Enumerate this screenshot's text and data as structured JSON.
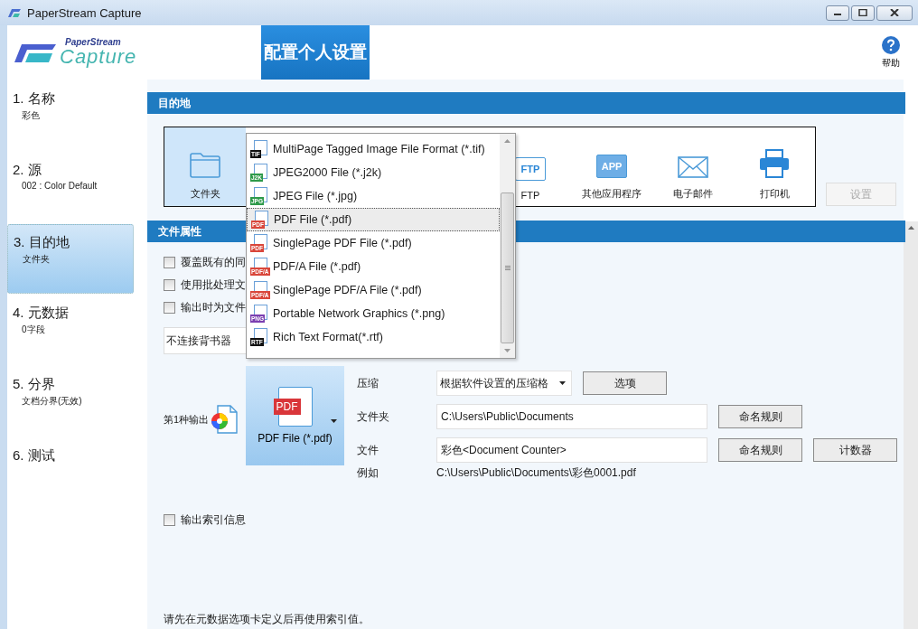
{
  "window": {
    "title": "PaperStream Capture"
  },
  "header": {
    "logo_top": "PaperStream",
    "logo_bottom": "Capture",
    "page_title": "配置个人设置",
    "help": "帮助"
  },
  "steps": [
    {
      "title": "1. 名称",
      "subtitle": "彩色",
      "selected": false
    },
    {
      "title": "2. 源",
      "subtitle": "002 : Color Default",
      "selected": false
    },
    {
      "title": "3. 目的地",
      "subtitle": "文件夹",
      "selected": true
    },
    {
      "title": "4. 元数据",
      "subtitle": "0字段",
      "selected": false
    },
    {
      "title": "5. 分界",
      "subtitle": "文档分界(无效)",
      "selected": false
    },
    {
      "title": "6. 测试",
      "selected": false
    }
  ],
  "destination": {
    "heading": "目的地",
    "items": [
      {
        "kind": "folder",
        "label": "文件夹",
        "selected": true
      },
      {
        "kind": "ftp",
        "label": "FTP",
        "icon_text": "FTP",
        "selected": false
      },
      {
        "kind": "app",
        "label": "其他应用程序",
        "icon_text": "APP",
        "selected": false
      },
      {
        "kind": "email",
        "label": "电子邮件",
        "selected": false
      },
      {
        "kind": "printer",
        "label": "打印机",
        "selected": false
      }
    ],
    "settings_button": {
      "label": "设置",
      "disabled": true
    }
  },
  "file_properties": {
    "heading": "文件属性",
    "options": [
      {
        "label": "覆盖既有的同",
        "checked": false
      },
      {
        "label": "使用批处理文",
        "checked": false
      },
      {
        "label": "输出时为文件",
        "checked": false
      }
    ],
    "endorser": "不连接背书器",
    "output_label": "第1种输出",
    "format": {
      "icon_text": "PDF",
      "label": "PDF File (*.pdf)"
    },
    "compression": {
      "label": "压缩",
      "value": "根据软件设置的压缩格",
      "button": "选项"
    },
    "folder": {
      "label": "文件夹",
      "value": "C:\\Users\\Public\\Documents",
      "button": "命名规则"
    },
    "file": {
      "label": "文件",
      "value": "彩色<Document Counter>",
      "button": "命名规则",
      "button_2": "计数器"
    },
    "example": {
      "label": "例如",
      "value": "C:\\Users\\Public\\Documents\\彩色0001.pdf"
    },
    "index_option": {
      "label": "输出索引信息",
      "checked": false
    },
    "note": "请先在元数据选项卡定义后再使用索引值。"
  },
  "format_menu": {
    "items": [
      {
        "badge": "TIF",
        "color": "#111111",
        "label": "MultiPage Tagged Image File Format (*.tif)",
        "selected": false
      },
      {
        "badge": "J2K",
        "color": "#2e9a4a",
        "label": "JPEG2000 File (*.j2k)",
        "selected": false
      },
      {
        "badge": "JPG",
        "color": "#2e9a4a",
        "label": "JPEG File (*.jpg)",
        "selected": false
      },
      {
        "badge": "PDF",
        "color": "#d9463a",
        "label": "PDF File (*.pdf)",
        "selected": true
      },
      {
        "badge": "PDF",
        "color": "#d9463a",
        "label": "SinglePage PDF File (*.pdf)",
        "selected": false
      },
      {
        "badge": "PDF/A",
        "color": "#d9463a",
        "label": "PDF/A File (*.pdf)",
        "selected": false
      },
      {
        "badge": "PDF/A",
        "color": "#d9463a",
        "label": "SinglePage PDF/A File (*.pdf)",
        "selected": false
      },
      {
        "badge": "PNG",
        "color": "#7b3fb0",
        "label": "Portable Network Graphics (*.png)",
        "selected": false
      },
      {
        "badge": "RTF",
        "color": "#111111",
        "label": "Rich Text Format(*.rtf)",
        "selected": false
      }
    ]
  }
}
